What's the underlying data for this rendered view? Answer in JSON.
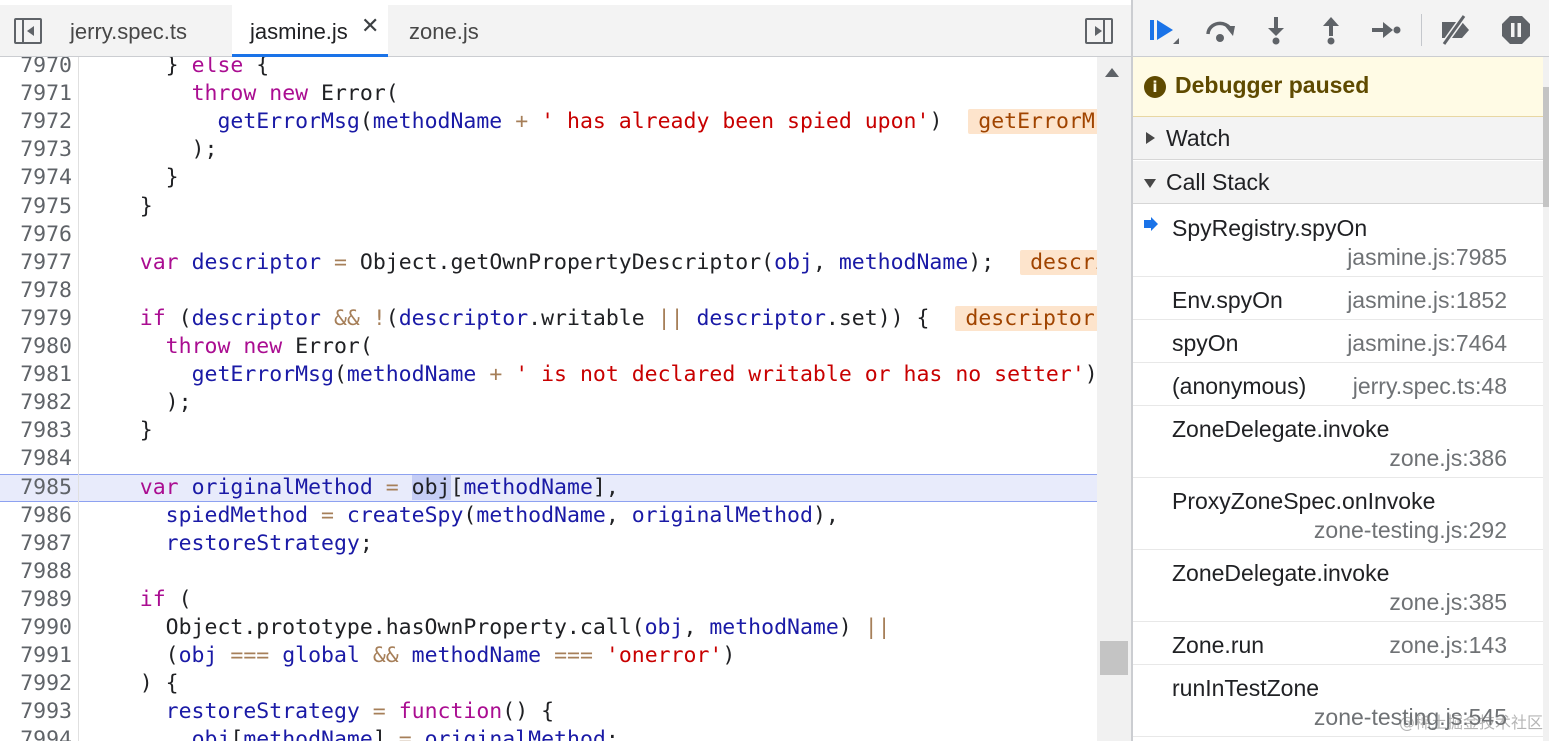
{
  "editor": {
    "tabs": [
      {
        "label": "jerry.spec.ts",
        "active": false
      },
      {
        "label": "jasmine.js",
        "active": true,
        "closable": true
      },
      {
        "label": "zone.js",
        "active": false
      }
    ],
    "close_glyph": "✕",
    "current_line": 7985,
    "lines": [
      {
        "n": "7970",
        "tokens": [
          [
            "p",
            "      } "
          ],
          [
            "kw",
            "else"
          ],
          [
            "p",
            " {"
          ]
        ]
      },
      {
        "n": "7971",
        "tokens": [
          [
            "p",
            "        "
          ],
          [
            "kw",
            "throw"
          ],
          [
            "p",
            " "
          ],
          [
            "kw",
            "new"
          ],
          [
            "p",
            " Error("
          ]
        ]
      },
      {
        "n": "7972",
        "tokens": [
          [
            "p",
            "          "
          ],
          [
            "va",
            "getErrorMsg"
          ],
          [
            "p",
            "("
          ],
          [
            "va",
            "methodName"
          ],
          [
            "p",
            " "
          ],
          [
            "op",
            "+"
          ],
          [
            "p",
            " "
          ],
          [
            "st",
            "' has already been spied upon'"
          ],
          [
            "p",
            ")  "
          ],
          [
            "iv",
            "getErrorMsg = f getErrorMsg(message)"
          ]
        ]
      },
      {
        "n": "7973",
        "tokens": [
          [
            "p",
            "        );"
          ]
        ]
      },
      {
        "n": "7974",
        "tokens": [
          [
            "p",
            "      }"
          ]
        ]
      },
      {
        "n": "7975",
        "tokens": [
          [
            "p",
            "    }"
          ]
        ]
      },
      {
        "n": "7976",
        "tokens": []
      },
      {
        "n": "7977",
        "tokens": [
          [
            "p",
            "    "
          ],
          [
            "kw",
            "var"
          ],
          [
            "p",
            " "
          ],
          [
            "va",
            "descriptor"
          ],
          [
            "p",
            " "
          ],
          [
            "op",
            "="
          ],
          [
            "p",
            " Object.getOwnPropertyDescriptor("
          ],
          [
            "va",
            "obj"
          ],
          [
            "p",
            ", "
          ],
          [
            "va",
            "methodName"
          ],
          [
            "p",
            ");  "
          ],
          [
            "iv",
            "descriptor = {value: f, writable: true}"
          ]
        ]
      },
      {
        "n": "7978",
        "tokens": []
      },
      {
        "n": "7979",
        "tokens": [
          [
            "p",
            "    "
          ],
          [
            "kw",
            "if"
          ],
          [
            "p",
            " ("
          ],
          [
            "va",
            "descriptor"
          ],
          [
            "p",
            " "
          ],
          [
            "op",
            "&&"
          ],
          [
            "p",
            " "
          ],
          [
            "op",
            "!"
          ],
          [
            "p",
            "("
          ],
          [
            "va",
            "descriptor"
          ],
          [
            "p",
            ".writable "
          ],
          [
            "op",
            "||"
          ],
          [
            "p",
            " "
          ],
          [
            "va",
            "descriptor"
          ],
          [
            "p",
            ".set)) {  "
          ],
          [
            "iv",
            "descriptor = {value: f}"
          ]
        ]
      },
      {
        "n": "7980",
        "tokens": [
          [
            "p",
            "      "
          ],
          [
            "kw",
            "throw"
          ],
          [
            "p",
            " "
          ],
          [
            "kw",
            "new"
          ],
          [
            "p",
            " Error("
          ]
        ]
      },
      {
        "n": "7981",
        "tokens": [
          [
            "p",
            "        "
          ],
          [
            "va",
            "getErrorMsg"
          ],
          [
            "p",
            "("
          ],
          [
            "va",
            "methodName"
          ],
          [
            "p",
            " "
          ],
          [
            "op",
            "+"
          ],
          [
            "p",
            " "
          ],
          [
            "st",
            "' is not declared writable or has no setter'"
          ],
          [
            "p",
            ")"
          ]
        ]
      },
      {
        "n": "7982",
        "tokens": [
          [
            "p",
            "      );"
          ]
        ]
      },
      {
        "n": "7983",
        "tokens": [
          [
            "p",
            "    }"
          ]
        ]
      },
      {
        "n": "7984",
        "tokens": []
      },
      {
        "n": "7985",
        "tokens": [
          [
            "p",
            "    "
          ],
          [
            "kw",
            "var"
          ],
          [
            "p",
            " "
          ],
          [
            "va",
            "originalMethod"
          ],
          [
            "p",
            " "
          ],
          [
            "op",
            "="
          ],
          [
            "p",
            " "
          ],
          [
            "hl",
            "obj"
          ],
          [
            "p",
            "["
          ],
          [
            "va",
            "methodName"
          ],
          [
            "p",
            "],"
          ]
        ]
      },
      {
        "n": "7986",
        "tokens": [
          [
            "p",
            "      "
          ],
          [
            "va",
            "spiedMethod"
          ],
          [
            "p",
            " "
          ],
          [
            "op",
            "="
          ],
          [
            "p",
            " "
          ],
          [
            "va",
            "createSpy"
          ],
          [
            "p",
            "("
          ],
          [
            "va",
            "methodName"
          ],
          [
            "p",
            ", "
          ],
          [
            "va",
            "originalMethod"
          ],
          [
            "p",
            "),"
          ]
        ]
      },
      {
        "n": "7987",
        "tokens": [
          [
            "p",
            "      "
          ],
          [
            "va",
            "restoreStrategy"
          ],
          [
            "p",
            ";"
          ]
        ]
      },
      {
        "n": "7988",
        "tokens": []
      },
      {
        "n": "7989",
        "tokens": [
          [
            "p",
            "    "
          ],
          [
            "kw",
            "if"
          ],
          [
            "p",
            " ("
          ]
        ]
      },
      {
        "n": "7990",
        "tokens": [
          [
            "p",
            "      Object.prototype.hasOwnProperty.call("
          ],
          [
            "va",
            "obj"
          ],
          [
            "p",
            ", "
          ],
          [
            "va",
            "methodName"
          ],
          [
            "p",
            ") "
          ],
          [
            "op",
            "||"
          ]
        ]
      },
      {
        "n": "7991",
        "tokens": [
          [
            "p",
            "      ("
          ],
          [
            "va",
            "obj"
          ],
          [
            "p",
            " "
          ],
          [
            "op",
            "==="
          ],
          [
            "p",
            " "
          ],
          [
            "va",
            "global"
          ],
          [
            "p",
            " "
          ],
          [
            "op",
            "&&"
          ],
          [
            "p",
            " "
          ],
          [
            "va",
            "methodName"
          ],
          [
            "p",
            " "
          ],
          [
            "op",
            "==="
          ],
          [
            "p",
            " "
          ],
          [
            "st",
            "'onerror'"
          ],
          [
            "p",
            ")"
          ]
        ]
      },
      {
        "n": "7992",
        "tokens": [
          [
            "p",
            "    ) {"
          ]
        ]
      },
      {
        "n": "7993",
        "tokens": [
          [
            "p",
            "      "
          ],
          [
            "va",
            "restoreStrategy"
          ],
          [
            "p",
            " "
          ],
          [
            "op",
            "="
          ],
          [
            "p",
            " "
          ],
          [
            "kw",
            "function"
          ],
          [
            "p",
            "() {"
          ]
        ]
      },
      {
        "n": "7994",
        "tokens": [
          [
            "p",
            "        "
          ],
          [
            "va",
            "obj"
          ],
          [
            "p",
            "["
          ],
          [
            "va",
            "methodName"
          ],
          [
            "p",
            "] "
          ],
          [
            "op",
            "="
          ],
          [
            "p",
            " "
          ],
          [
            "va",
            "originalMethod"
          ],
          [
            "p",
            ";"
          ]
        ]
      }
    ]
  },
  "debugger": {
    "paused_label": "Debugger paused",
    "paused_icon": "i",
    "watch_label": "Watch",
    "callstack_label": "Call Stack",
    "frames": [
      {
        "fn": "SpyRegistry.spyOn",
        "loc": "jasmine.js:7985",
        "current": true,
        "two_line": true
      },
      {
        "fn": "Env.spyOn",
        "loc": "jasmine.js:1852",
        "current": false,
        "two_line": false
      },
      {
        "fn": "spyOn",
        "loc": "jasmine.js:7464",
        "current": false,
        "two_line": false
      },
      {
        "fn": "(anonymous)",
        "loc": "jerry.spec.ts:48",
        "current": false,
        "two_line": false
      },
      {
        "fn": "ZoneDelegate.invoke",
        "loc": "zone.js:386",
        "current": false,
        "two_line": true
      },
      {
        "fn": "ProxyZoneSpec.onInvoke",
        "loc": "zone-testing.js:292",
        "current": false,
        "two_line": true
      },
      {
        "fn": "ZoneDelegate.invoke",
        "loc": "zone.js:385",
        "current": false,
        "two_line": true
      },
      {
        "fn": "Zone.run",
        "loc": "zone.js:143",
        "current": false,
        "two_line": false
      },
      {
        "fn": "runInTestZone",
        "loc": "zone-testing.js:545",
        "current": false,
        "two_line": true
      }
    ]
  },
  "toolbar": {
    "buttons": [
      "resume-icon",
      "step-over-icon",
      "step-into-icon",
      "step-out-icon",
      "step-icon",
      "deactivate-breakpoints-icon",
      "pause-on-exceptions-icon"
    ]
  },
  "colors": {
    "accent": "#1a73e8",
    "paused_banner": "#fffbe5",
    "current_line": "#e8ebfb"
  },
  "watermark": "@稀土掘金技术社区"
}
